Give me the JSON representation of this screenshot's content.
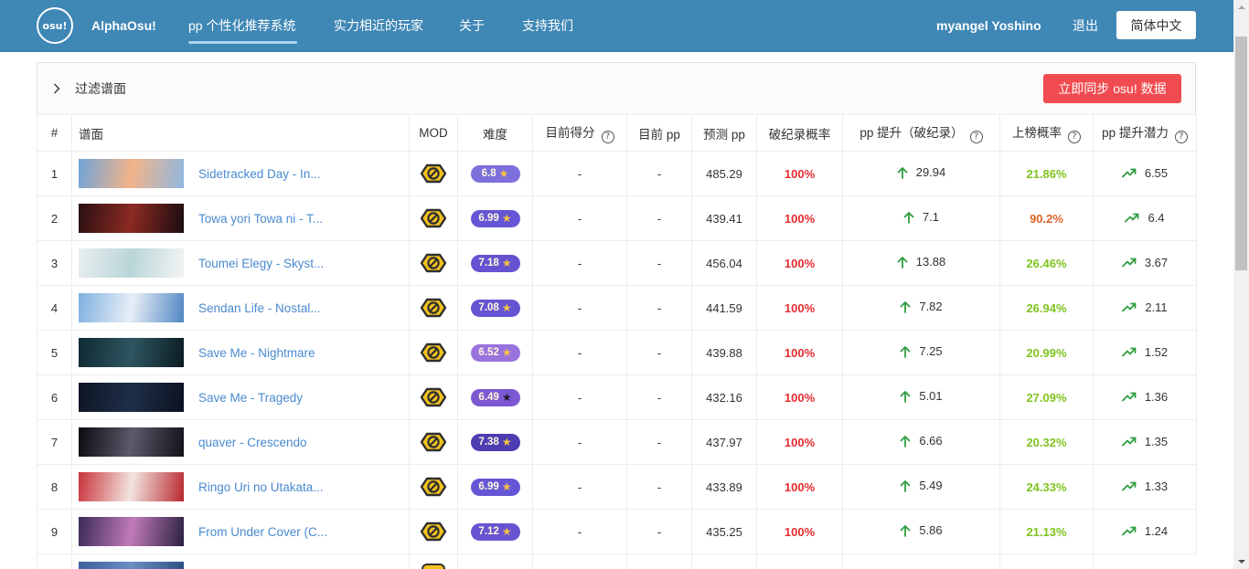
{
  "navbar": {
    "logo_text": "osu!",
    "brand": "AlphaOsu!",
    "links": [
      {
        "label": "pp 个性化推荐系统",
        "active": true
      },
      {
        "label": "实力相近的玩家",
        "active": false
      },
      {
        "label": "关于",
        "active": false
      },
      {
        "label": "支持我们",
        "active": false
      }
    ],
    "username": "myangel Yoshino",
    "logout": "退出",
    "language": "简体中文"
  },
  "filter": {
    "label": "过滤谱面",
    "sync_button": "立即同步 osu! 数据"
  },
  "table": {
    "headers": {
      "rank": "#",
      "map": "谱面",
      "mod": "MOD",
      "difficulty": "难度",
      "current_score": "目前得分",
      "current_pp": "目前 pp",
      "predicted_pp": "预测 pp",
      "break_prob": "破纪录概率",
      "pp_gain": "pp 提升（破纪录）",
      "rank_prob": "上榜概率",
      "potential": "pp 提升潜力"
    },
    "rows": [
      {
        "rank": "1",
        "title": "Sidetracked Day - In...",
        "thumb": [
          "#6fa3d8",
          "#f2b48a",
          "#8fb7e0"
        ],
        "mod_icon": "no-mod-icon",
        "stars": "6.8",
        "badge_color": "#7d6fdc",
        "star_color": "#f6c344",
        "current_score": "-",
        "current_pp": "-",
        "predicted_pp": "485.29",
        "break_prob": "100%",
        "pp_gain": "29.94",
        "rank_prob": "21.86%",
        "rank_prob_color": "#7fc31f",
        "potential": "6.55"
      },
      {
        "rank": "2",
        "title": "Towa yori Towa ni - T...",
        "thumb": [
          "#2a1012",
          "#8c2a22",
          "#1a0c10"
        ],
        "mod_icon": "no-mod-icon",
        "stars": "6.99",
        "badge_color": "#6556d6",
        "star_color": "#f6c344",
        "current_score": "-",
        "current_pp": "-",
        "predicted_pp": "439.41",
        "break_prob": "100%",
        "pp_gain": "7.1",
        "rank_prob": "90.2%",
        "rank_prob_color": "#e0652a",
        "potential": "6.4"
      },
      {
        "rank": "3",
        "title": "Toumei Elegy - Skyst...",
        "thumb": [
          "#e9eef0",
          "#b9d6d8",
          "#f4f4f4"
        ],
        "mod_icon": "no-mod-icon",
        "stars": "7.18",
        "badge_color": "#6452d0",
        "star_color": "#f6c344",
        "current_score": "-",
        "current_pp": "-",
        "predicted_pp": "456.04",
        "break_prob": "100%",
        "pp_gain": "13.88",
        "rank_prob": "26.46%",
        "rank_prob_color": "#7fc31f",
        "potential": "3.67"
      },
      {
        "rank": "4",
        "title": "Sendan Life - Nostal...",
        "thumb": [
          "#7fb1e0",
          "#e8eef6",
          "#4f86c2"
        ],
        "mod_icon": "no-mod-icon",
        "stars": "7.08",
        "badge_color": "#6655d2",
        "star_color": "#f6c344",
        "current_score": "-",
        "current_pp": "-",
        "predicted_pp": "441.59",
        "break_prob": "100%",
        "pp_gain": "7.82",
        "rank_prob": "26.94%",
        "rank_prob_color": "#7fc31f",
        "potential": "2.11"
      },
      {
        "rank": "5",
        "title": "Save Me - Nightmare",
        "thumb": [
          "#0f2a33",
          "#2e5560",
          "#0b1c22"
        ],
        "mod_icon": "no-mod-icon",
        "stars": "6.52",
        "badge_color": "#9a72dd",
        "star_color": "#f6c344",
        "current_score": "-",
        "current_pp": "-",
        "predicted_pp": "439.88",
        "break_prob": "100%",
        "pp_gain": "7.25",
        "rank_prob": "20.99%",
        "rank_prob_color": "#7fc31f",
        "potential": "1.52"
      },
      {
        "rank": "6",
        "title": "Save Me - Tragedy",
        "thumb": [
          "#0c1524",
          "#1f2e48",
          "#0a1220"
        ],
        "mod_icon": "no-mod-icon",
        "stars": "6.49",
        "badge_color": "#7c58d2",
        "star_color": "#1f1a2e",
        "current_score": "-",
        "current_pp": "-",
        "predicted_pp": "432.16",
        "break_prob": "100%",
        "pp_gain": "5.01",
        "rank_prob": "27.09%",
        "rank_prob_color": "#7fc31f",
        "potential": "1.36"
      },
      {
        "rank": "7",
        "title": "quaver - Crescendo",
        "thumb": [
          "#0a0a0f",
          "#5a5a6a",
          "#111118"
        ],
        "mod_icon": "no-mod-icon",
        "stars": "7.38",
        "badge_color": "#4c3db3",
        "star_color": "#f6c344",
        "current_score": "-",
        "current_pp": "-",
        "predicted_pp": "437.97",
        "break_prob": "100%",
        "pp_gain": "6.66",
        "rank_prob": "20.32%",
        "rank_prob_color": "#7fc31f",
        "potential": "1.35"
      },
      {
        "rank": "8",
        "title": "Ringo Uri no Utakata...",
        "thumb": [
          "#c9333b",
          "#f2e4e0",
          "#b8282e"
        ],
        "mod_icon": "no-mod-icon",
        "stars": "6.99",
        "badge_color": "#6556d6",
        "star_color": "#f6c344",
        "current_score": "-",
        "current_pp": "-",
        "predicted_pp": "433.89",
        "break_prob": "100%",
        "pp_gain": "5.49",
        "rank_prob": "24.33%",
        "rank_prob_color": "#7fc31f",
        "potential": "1.33"
      },
      {
        "rank": "9",
        "title": "From Under Cover (C...",
        "thumb": [
          "#3a2a5a",
          "#c07ab8",
          "#2a2140"
        ],
        "mod_icon": "no-mod-icon",
        "stars": "7.12",
        "badge_color": "#6853d1",
        "star_color": "#f6c344",
        "current_score": "-",
        "current_pp": "-",
        "predicted_pp": "435.25",
        "break_prob": "100%",
        "pp_gain": "5.86",
        "rank_prob": "21.13%",
        "rank_prob_color": "#7fc31f",
        "potential": "1.24"
      }
    ],
    "partial_row": {
      "thumb": [
        "#3a5f9a",
        "#6a8fc4",
        "#2e4f86"
      ],
      "mod_icon": "no-mod-icon"
    }
  },
  "icons": {
    "filter_toggle": "chevron-right-icon",
    "help": "help-circle-icon",
    "pp_gain": "arrow-up-icon",
    "potential": "trending-up-icon",
    "mod": "no-mod-icon",
    "star": "star-icon"
  },
  "theme": {
    "nav_bg": "#3f87b5",
    "nav_underline": "#a9d5f0",
    "link": "#4a8ad0",
    "sync_bg": "#f04b50",
    "break_prob": "#e52b2f",
    "gain_icon": "#2f9e3f",
    "border": "#ececec"
  }
}
